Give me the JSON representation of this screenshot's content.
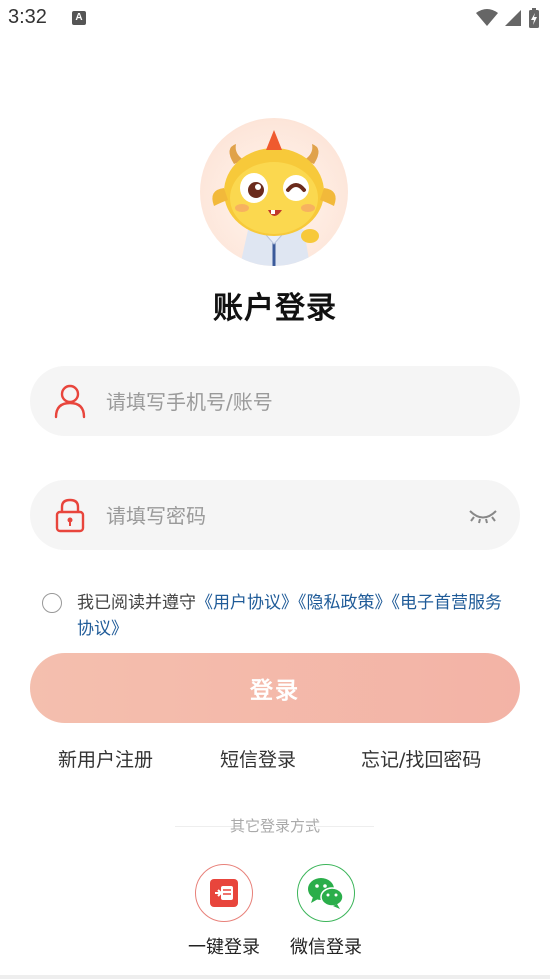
{
  "status_bar": {
    "time": "3:32",
    "notification_letter": "A"
  },
  "page": {
    "title": "账户登录"
  },
  "phone_field": {
    "placeholder": "请填写手机号/账号",
    "value": ""
  },
  "password_field": {
    "placeholder": "请填写密码",
    "value": ""
  },
  "agreement": {
    "checked": false,
    "prefix": "我已阅读并遵守",
    "links": [
      "《用户协议》",
      "《隐私政策》",
      "《电子首营服务协议》"
    ]
  },
  "login_button": {
    "label": "登录"
  },
  "links": {
    "register": "新用户注册",
    "sms_login": "短信登录",
    "forgot_password": "忘记/找回密码"
  },
  "other_login": {
    "title": "其它登录方式",
    "options": [
      {
        "label": "一键登录",
        "icon": "phone-login-icon"
      },
      {
        "label": "微信登录",
        "icon": "wechat-icon"
      }
    ]
  },
  "colors": {
    "accent_red": "#e8453c",
    "link_blue": "#1f5b98",
    "wechat_green": "#2aae4a",
    "button_peach": "#f3b9aa"
  }
}
